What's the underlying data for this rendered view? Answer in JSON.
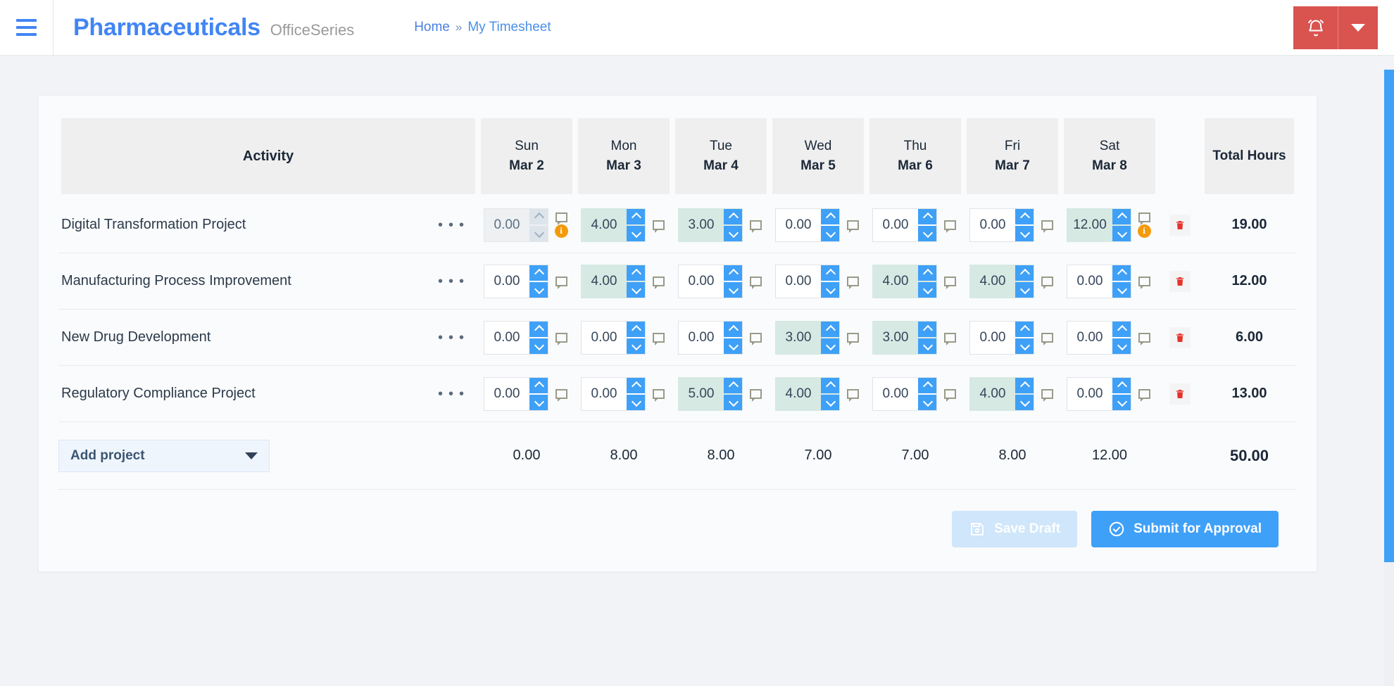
{
  "topbar": {
    "menu_icon": "hamburger-icon",
    "brand": "Pharmaceuticals",
    "brand_sub": "OfficeSeries",
    "breadcrumb": {
      "home": "Home",
      "separator": "»",
      "current": "My Timesheet"
    },
    "alert_icon": "bell-icon",
    "alert_caret_icon": "chevron-down-icon",
    "alert_color": "#d9534f",
    "brand_color": "#4285f4"
  },
  "table": {
    "activity_header": "Activity",
    "total_header": "Total Hours",
    "days": [
      {
        "dow": "Sun",
        "date": "Mar 2"
      },
      {
        "dow": "Mon",
        "date": "Mar 3"
      },
      {
        "dow": "Tue",
        "date": "Mar 4"
      },
      {
        "dow": "Wed",
        "date": "Mar 5"
      },
      {
        "dow": "Thu",
        "date": "Mar 6"
      },
      {
        "dow": "Fri",
        "date": "Mar 7"
      },
      {
        "dow": "Sat",
        "date": "Mar 8"
      }
    ],
    "rows": [
      {
        "name": "Digital Transformation Project",
        "menu_icon": "ellipsis-icon",
        "values": [
          "0.00",
          "4.00",
          "3.00",
          "0.00",
          "0.00",
          "0.00",
          "12.00"
        ],
        "disabled": [
          true,
          false,
          false,
          false,
          false,
          false,
          false
        ],
        "warnings": [
          true,
          false,
          false,
          false,
          false,
          false,
          true
        ],
        "delete_icon": "trash-icon",
        "total": "19.00"
      },
      {
        "name": "Manufacturing Process Improvement",
        "menu_icon": "ellipsis-icon",
        "values": [
          "0.00",
          "4.00",
          "0.00",
          "0.00",
          "4.00",
          "4.00",
          "0.00"
        ],
        "disabled": [
          false,
          false,
          false,
          false,
          false,
          false,
          false
        ],
        "warnings": [
          false,
          false,
          false,
          false,
          false,
          false,
          false
        ],
        "delete_icon": "trash-icon",
        "total": "12.00"
      },
      {
        "name": "New Drug Development",
        "menu_icon": "ellipsis-icon",
        "values": [
          "0.00",
          "0.00",
          "0.00",
          "3.00",
          "3.00",
          "0.00",
          "0.00"
        ],
        "disabled": [
          false,
          false,
          false,
          false,
          false,
          false,
          false
        ],
        "warnings": [
          false,
          false,
          false,
          false,
          false,
          false,
          false
        ],
        "delete_icon": "trash-icon",
        "total": "6.00"
      },
      {
        "name": "Regulatory Compliance Project",
        "menu_icon": "ellipsis-icon",
        "values": [
          "0.00",
          "0.00",
          "5.00",
          "4.00",
          "0.00",
          "4.00",
          "0.00"
        ],
        "disabled": [
          false,
          false,
          false,
          false,
          false,
          false,
          false
        ],
        "warnings": [
          false,
          false,
          false,
          false,
          false,
          false,
          false
        ],
        "delete_icon": "trash-icon",
        "total": "13.00"
      }
    ],
    "footer": {
      "add_project_label": "Add project",
      "add_project_caret_icon": "caret-down-icon",
      "day_totals": [
        "0.00",
        "8.00",
        "8.00",
        "7.00",
        "7.00",
        "8.00",
        "12.00"
      ],
      "grand_total": "50.00"
    },
    "spinner_up_icon": "chevron-up-icon",
    "spinner_down_icon": "chevron-down-icon",
    "note_icon": "comment-icon",
    "warning_icon": "info-badge-icon",
    "warning_symbol": "i"
  },
  "actions": {
    "save_draft": {
      "label": "Save Draft",
      "icon": "save-disk-icon",
      "disabled": true
    },
    "submit": {
      "label": "Submit for Approval",
      "icon": "check-circle-icon",
      "color": "#3fa0f7"
    }
  }
}
